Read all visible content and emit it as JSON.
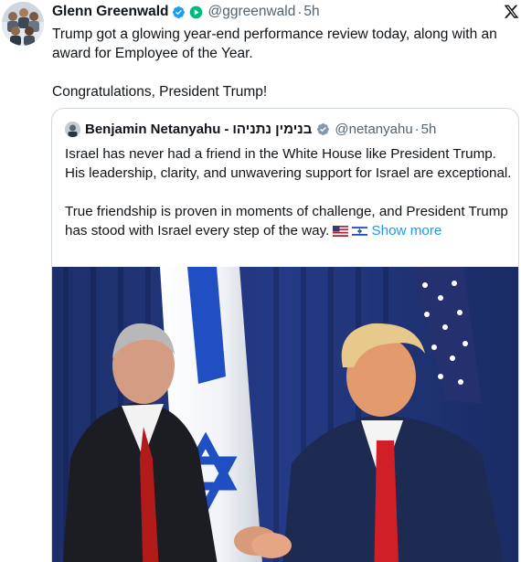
{
  "post": {
    "author_name": "Glenn Greenwald",
    "handle": "@ggreenwald",
    "separator": "·",
    "time": "5h",
    "text_line1": "Trump got a glowing year-end performance review today, along with an award for Employee of the Year.",
    "text_line2": "Congratulations, President Trump!"
  },
  "quote": {
    "author_name": "Benjamin Netanyahu",
    "author_name_hebrew": "בנימין נתניהו",
    "dash": "-",
    "handle": "@netanyahu",
    "separator": "·",
    "time": "5h",
    "paragraph1": "Israel has never had a friend in the White House like President Trump. His leadership, clarity, and unwavering support for Israel are exceptional.",
    "paragraph2": "True friendship is proven in moments of challenge, and President Trump has stood with Israel every step of the way.",
    "show_more": "Show more"
  },
  "icons": {
    "verified": "blue-check-badge",
    "subscription": "green-play-badge",
    "close": "x-icon",
    "flags": [
      "us-flag",
      "israel-flag"
    ]
  },
  "colors": {
    "link": "#1d9bf0",
    "secondary_text": "#536471",
    "verified_blue": "#1d9bf0",
    "green_badge": "#00ba7c"
  }
}
